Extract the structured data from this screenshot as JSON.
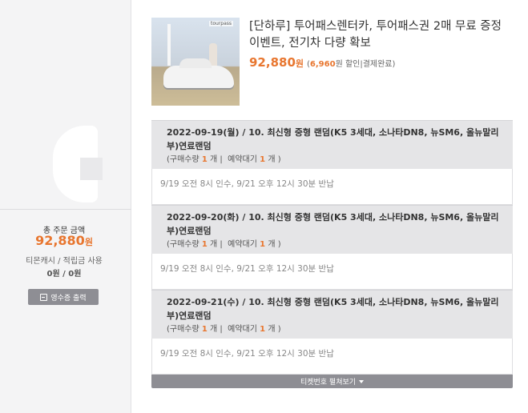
{
  "summary": {
    "total_label": "총 주문 금액",
    "total_amount": "92,880",
    "currency": "원",
    "cash_label": "티몬캐시 / 적립금 사용",
    "cash_value": "0원 / 0원",
    "receipt_button": "영수증 출력",
    "receipt_icon": "printer-icon"
  },
  "product": {
    "thumb_brand": "tourpass",
    "title": "[단하루] 투어패스렌터카, 투어패스권 2매 무료 증정이벤트, 전기차 다량 확보",
    "price": "92,880",
    "price_unit": "원",
    "discount_prefix": "(",
    "discount": "6,960",
    "discount_suffix": "원 할인|결제완료)"
  },
  "orders": [
    {
      "title": "2022-09-19(월) / 10. 최신형 중형 랜덤(K5 3세대, 소나타DN8, 뉴SM6, 올뉴말리부)연료랜덤",
      "qty_label": "(구매수량",
      "qty": "1",
      "qty_unit": "개",
      "wait_label": "예약대기",
      "wait": "1",
      "wait_unit": "개 )",
      "note": "9/19 오전 8시 인수, 9/21 오후 12시 30분 반납"
    },
    {
      "title": "2022-09-20(화) / 10. 최신형 중형 랜덤(K5 3세대, 소나타DN8, 뉴SM6, 올뉴말리부)연료랜덤",
      "qty_label": "(구매수량",
      "qty": "1",
      "qty_unit": "개",
      "wait_label": "예약대기",
      "wait": "1",
      "wait_unit": "개 )",
      "note": "9/19 오전 8시 인수, 9/21 오후 12시 30분 반납"
    },
    {
      "title": "2022-09-21(수) / 10. 최신형 중형 랜덤(K5 3세대, 소나타DN8, 뉴SM6, 올뉴말리부)연료랜덤",
      "qty_label": "(구매수량",
      "qty": "1",
      "qty_unit": "개",
      "wait_label": "예약대기",
      "wait": "1",
      "wait_unit": "개 )",
      "note": "9/19 오전 8시 인수, 9/21 오후 12시 30분 반납"
    }
  ],
  "expand_bar": {
    "label": "티켓번호 펼쳐보기",
    "icon": "caret-down-icon"
  }
}
